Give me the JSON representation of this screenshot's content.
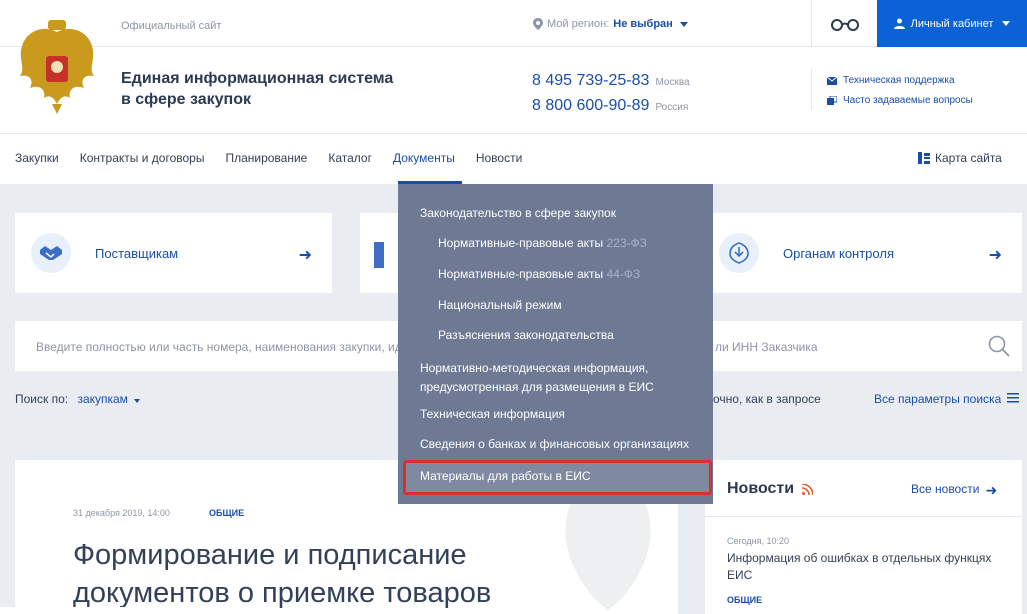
{
  "header": {
    "official_site": "Официальный сайт",
    "region_label": "Мой регион:",
    "region_value": "Не выбран",
    "cabinet_label": "Личный кабинет",
    "site_title_line1": "Единая информационная система",
    "site_title_line2": "в сфере закупок",
    "phone1": "8 495 739-25-83",
    "phone1_city": "Москва",
    "phone2": "8 800 600-90-89",
    "phone2_city": "Россия",
    "support": "Техническая поддержка",
    "faq": "Часто задаваемые вопросы"
  },
  "nav": {
    "items": [
      "Закупки",
      "Контракты и договоры",
      "Планирование",
      "Каталог",
      "Документы",
      "Новости"
    ],
    "active_index": 4,
    "sitemap": "Карта сайта"
  },
  "cards": {
    "suppliers": "Поставщикам",
    "control": "Органам контроля"
  },
  "search": {
    "placeholder_left": "Введите полностью или часть номера, наименования закупки, ид",
    "placeholder_right": "ли ИНН Заказчика",
    "search_by_label": "Поиск по:",
    "search_by_value": "закупкам",
    "exact": "очно, как в запросе",
    "all_params": "Все параметры поиска"
  },
  "article": {
    "date": "31 декабря 2019, 14:00",
    "tag": "ОБЩИЕ",
    "title_line1": "Формирование и подписание",
    "title_line2": "документов о приемке товаров"
  },
  "news": {
    "title": "Новости",
    "all": "Все новости",
    "item_date": "Сегодня, 10:20",
    "item_text": "Информация об ошибках в отдельных функцях ЕИС",
    "item_tag": "ОБЩИЕ"
  },
  "dropdown": {
    "items": [
      {
        "label": "Законодательство в сфере закупок",
        "extra": ""
      },
      {
        "label": "Нормативные-правовые акты",
        "extra": "223-ФЗ"
      },
      {
        "label": "Нормативные-правовые акты",
        "extra": "44-ФЗ"
      },
      {
        "label": "Национальный режим",
        "extra": ""
      },
      {
        "label": "Разъяснения законодательства",
        "extra": ""
      },
      {
        "label": "Нормативно-методическая информация,",
        "extra": ""
      },
      {
        "label": "предусмотренная для размещения в ЕИС",
        "extra": ""
      },
      {
        "label": "Техническая информация",
        "extra": ""
      },
      {
        "label": "Сведения о банках и финансовых организациях",
        "extra": ""
      },
      {
        "label": "Материалы для работы в ЕИС",
        "extra": ""
      }
    ],
    "highlight_color": "#d9302b"
  },
  "colors": {
    "accent": "#1a4ea6",
    "brand_button": "#0a62d6",
    "dropdown_bg": "#6e7a93"
  }
}
